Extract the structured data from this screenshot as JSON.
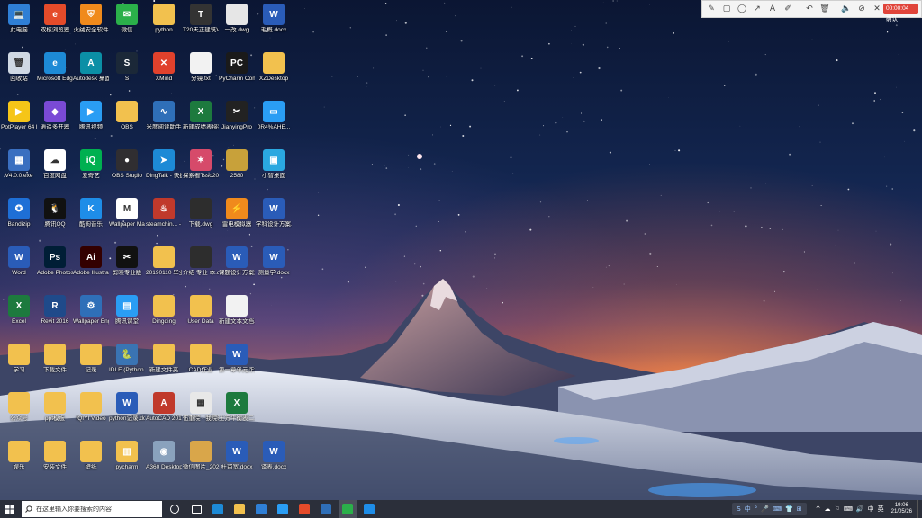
{
  "desktop": {
    "icons": [
      {
        "label": "此电脑",
        "color": "#2f7fd6",
        "glyph": "💻"
      },
      {
        "label": "双核浏览器",
        "color": "#e54b2a",
        "glyph": "e"
      },
      {
        "label": "火绒安全软件",
        "color": "#f08a1c",
        "glyph": "⛨"
      },
      {
        "label": "微信",
        "color": "#2bb04a",
        "glyph": "✉"
      },
      {
        "label": "python",
        "color": "#f2c14e",
        "glyph": ""
      },
      {
        "label": "T20天正建筑V5.0",
        "color": "#333333",
        "glyph": "T"
      },
      {
        "label": "一改.dwg",
        "color": "#e6e6e6",
        "glyph": ""
      },
      {
        "label": "毛概.docx",
        "color": "#2a5cb8",
        "glyph": "W"
      },
      {
        "label": "回收站",
        "color": "#cfd8e3",
        "glyph": "🗑"
      },
      {
        "label": "Microsoft Edge",
        "color": "#1d8ad6",
        "glyph": "e"
      },
      {
        "label": "Autodesk 桌面应用程序",
        "color": "#0b8fa6",
        "glyph": "A"
      },
      {
        "label": "S",
        "color": "#1b2838",
        "glyph": "S"
      },
      {
        "label": "XMind",
        "color": "#e0412c",
        "glyph": "✕"
      },
      {
        "label": "分镜.txt",
        "color": "#f2f2f2",
        "glyph": ""
      },
      {
        "label": "PyCharm Communit...",
        "color": "#1a1a1a",
        "glyph": "PC"
      },
      {
        "label": "XZDesktop",
        "color": "#f2c14e",
        "glyph": ""
      },
      {
        "label": "PotPlayer 64 bit",
        "color": "#f5c518",
        "glyph": "▶"
      },
      {
        "label": "逍遥多开器",
        "color": "#7a4ad6",
        "glyph": "◆"
      },
      {
        "label": "腾讯视频",
        "color": "#2a9df4",
        "glyph": "▶"
      },
      {
        "label": "OBS",
        "color": "#f2c14e",
        "glyph": ""
      },
      {
        "label": "米度阅读助手",
        "color": "#2f6fb8",
        "glyph": "∿"
      },
      {
        "label": "新建成绩表接种人员统...",
        "color": "#1d7a3e",
        "glyph": "X"
      },
      {
        "label": "JianyingPro",
        "color": "#222222",
        "glyph": "✂"
      },
      {
        "label": "0R4%AHE...",
        "color": "#2a9df4",
        "glyph": "▭"
      },
      {
        "label": "V4.0.0.exe",
        "color": "#3a6fc0",
        "glyph": "▦"
      },
      {
        "label": "百度网盘",
        "color": "#ffffff",
        "glyph": "☁"
      },
      {
        "label": "爱奇艺",
        "color": "#00b050",
        "glyph": "iQ"
      },
      {
        "label": "OBS Studio",
        "color": "#302e31",
        "glyph": "●"
      },
      {
        "label": "DingTalk - 快捷方式",
        "color": "#1d8ad6",
        "glyph": "➤"
      },
      {
        "label": "探索者Tsso2016",
        "color": "#d64a6a",
        "glyph": "✶"
      },
      {
        "label": "2580",
        "color": "#c8a13a",
        "glyph": ""
      },
      {
        "label": "小智桌面",
        "color": "#2aa8e0",
        "glyph": "▣"
      },
      {
        "label": "Bandizip",
        "color": "#1e6fd6",
        "glyph": "✪"
      },
      {
        "label": "腾讯QQ",
        "color": "#111111",
        "glyph": "🐧"
      },
      {
        "label": "酷狗音乐",
        "color": "#1e8de8",
        "glyph": "K"
      },
      {
        "label": "Wallpaper Maker - ...",
        "color": "#ffffff",
        "glyph": "M"
      },
      {
        "label": "steamchin... - 快捷方式",
        "color": "#c0392b",
        "glyph": "♨"
      },
      {
        "label": "下载.dwg",
        "color": "#2d2d2d",
        "glyph": ""
      },
      {
        "label": "雷电模拟器",
        "color": "#f08a1c",
        "glyph": "⚡"
      },
      {
        "label": "学科设计方案.docx",
        "color": "#2a5cb8",
        "glyph": "W"
      },
      {
        "label": "Word",
        "color": "#2a5cb8",
        "glyph": "W"
      },
      {
        "label": "Adobe Photosh...",
        "color": "#001e36",
        "glyph": "Ps"
      },
      {
        "label": "Adobe Illustrat...",
        "color": "#330000",
        "glyph": "Ai"
      },
      {
        "label": "剪映专业版",
        "color": "#111111",
        "glyph": "✂"
      },
      {
        "label": "20190110 毕业照",
        "color": "#f2c14e",
        "glyph": ""
      },
      {
        "label": "介绍 专业 本.dwg",
        "color": "#2d2d2d",
        "glyph": ""
      },
      {
        "label": "课题设计方案汇报.doc",
        "color": "#2a5cb8",
        "glyph": "W"
      },
      {
        "label": "测量学.docx",
        "color": "#2a5cb8",
        "glyph": "W"
      },
      {
        "label": "Excel",
        "color": "#1d7a3e",
        "glyph": "X"
      },
      {
        "label": "Revit 2016",
        "color": "#1f4a8a",
        "glyph": "R"
      },
      {
        "label": "Wallpaper Engine: ...",
        "color": "#2f6fb8",
        "glyph": "⚙"
      },
      {
        "label": "腾讯课堂",
        "color": "#2a9df4",
        "glyph": "▤"
      },
      {
        "label": "Dingding",
        "color": "#f2c14e",
        "glyph": ""
      },
      {
        "label": "User Data",
        "color": "#f2c14e",
        "glyph": ""
      },
      {
        "label": "新建文本文档.txt",
        "color": "#f2f2f2",
        "glyph": ""
      },
      {
        "label": "",
        "color": "",
        "glyph": ""
      },
      {
        "label": "学习",
        "color": "#f2c14e",
        "glyph": ""
      },
      {
        "label": "下载文件",
        "color": "#f2c14e",
        "glyph": ""
      },
      {
        "label": "记录",
        "color": "#f2c14e",
        "glyph": ""
      },
      {
        "label": "IDLE (Python ...",
        "color": "#3a74b3",
        "glyph": "🐍"
      },
      {
        "label": "新建文件夹",
        "color": "#f2c14e",
        "glyph": ""
      },
      {
        "label": "CAD作业",
        "color": "#f2c14e",
        "glyph": ""
      },
      {
        "label": "第一章单元作业 - 分析题...",
        "color": "#2a5cb8",
        "glyph": "W"
      },
      {
        "label": "",
        "color": "",
        "glyph": ""
      },
      {
        "label": "公众号",
        "color": "#f2c14e",
        "glyph": ""
      },
      {
        "label": "ppt模板",
        "color": "#f2c14e",
        "glyph": ""
      },
      {
        "label": "IQIYI Video",
        "color": "#f2c14e",
        "glyph": ""
      },
      {
        "label": "python记录.docx",
        "color": "#2a5cb8",
        "glyph": "W"
      },
      {
        "label": "AutoCAD 2016 - 简...",
        "color": "#c0392b",
        "glyph": "A"
      },
      {
        "label": "伍重院 - 我院的二层...",
        "color": "#e8e8e8",
        "glyph": "▦"
      },
      {
        "label": "土方平衡表二.xlsx",
        "color": "#1d7a3e",
        "glyph": "X"
      },
      {
        "label": "",
        "color": "",
        "glyph": ""
      },
      {
        "label": "娱乐",
        "color": "#f2c14e",
        "glyph": ""
      },
      {
        "label": "安装文件",
        "color": "#f2c14e",
        "glyph": ""
      },
      {
        "label": "壁纸",
        "color": "#f2c14e",
        "glyph": ""
      },
      {
        "label": "pycharm",
        "color": "#f2c14e",
        "glyph": "▥"
      },
      {
        "label": "A360 Desktop",
        "color": "#8aa2bd",
        "glyph": "◉"
      },
      {
        "label": "微信图片_2021050...",
        "color": "#d9a64a",
        "glyph": ""
      },
      {
        "label": "杜甫宽.docx",
        "color": "#2a5cb8",
        "glyph": "W"
      },
      {
        "label": "译表.docx",
        "color": "#2a5cb8",
        "glyph": "W"
      }
    ]
  },
  "recorder": {
    "tools": [
      {
        "name": "pen-icon",
        "glyph": "✎"
      },
      {
        "name": "rectangle-icon",
        "glyph": "▢"
      },
      {
        "name": "ellipse-icon",
        "glyph": "◯"
      },
      {
        "name": "arrow-icon",
        "glyph": "↗"
      },
      {
        "name": "text-icon",
        "glyph": "A"
      },
      {
        "name": "highlighter-icon",
        "glyph": "✐"
      },
      {
        "name": "undo-icon",
        "glyph": "↶"
      },
      {
        "name": "trash-icon",
        "glyph": "🗑"
      },
      {
        "name": "speaker-icon",
        "glyph": "🔈"
      },
      {
        "name": "camera-off-icon",
        "glyph": "⊘"
      },
      {
        "name": "close-icon",
        "glyph": "✕"
      }
    ],
    "timer": "00:00:04 确认"
  },
  "taskbar": {
    "search_placeholder": "在这里输入你要搜索的内容",
    "apps": [
      {
        "name": "cortana-icon",
        "color": "#ffffff",
        "active": false
      },
      {
        "name": "task-view-icon",
        "color": "#ffffff",
        "active": false
      },
      {
        "name": "edge-icon",
        "color": "#1d8ad6",
        "active": false
      },
      {
        "name": "file-explorer-icon",
        "color": "#f2c14e",
        "active": false
      },
      {
        "name": "store-icon",
        "color": "#2f7fd6",
        "active": false
      },
      {
        "name": "mail-icon",
        "color": "#2a9df4",
        "active": false
      },
      {
        "name": "chrome-icon",
        "color": "#e54b2a",
        "active": false
      },
      {
        "name": "autodesk-icon",
        "color": "#2f6fb8",
        "active": false
      },
      {
        "name": "recorder-app-icon",
        "color": "#2bb04a",
        "active": true
      },
      {
        "name": "kugou-icon",
        "color": "#1e8de8",
        "active": false
      }
    ],
    "ime": [
      "S",
      "中",
      "°",
      "🎤",
      "⌨",
      "👕",
      "⊞"
    ],
    "tray_icons": [
      "^",
      "☁",
      "⚐",
      "⌨",
      "🔊",
      "中",
      "英"
    ],
    "clock_time": "19:06",
    "clock_date": "21/05/26"
  }
}
